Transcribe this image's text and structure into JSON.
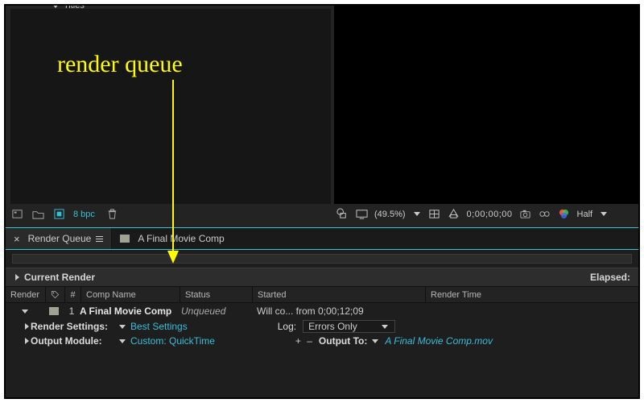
{
  "project": {
    "row_label": "Titles",
    "bpc_label": "8 bpc"
  },
  "viewer": {
    "zoom": "(49.5%)",
    "timecode": "0;00;00;00",
    "resolution": "Half"
  },
  "tabs": {
    "render_queue": "Render Queue",
    "comp_name": "A Final Movie Comp"
  },
  "current_render": {
    "title": "Current Render",
    "elapsed_label": "Elapsed:"
  },
  "columns": {
    "render": "Render",
    "tag": "",
    "num": "#",
    "comp": "Comp Name",
    "status": "Status",
    "started": "Started",
    "render_time": "Render Time"
  },
  "item": {
    "index": "1",
    "comp_name": "A Final Movie Comp",
    "status": "Unqueued",
    "started": "Will co... from 0;00;12;09",
    "render_settings_label": "Render Settings:",
    "render_settings_value": "Best Settings",
    "output_module_label": "Output Module:",
    "output_module_value": "Custom: QuickTime",
    "log_label": "Log:",
    "log_value": "Errors Only",
    "output_to_label": "Output To:",
    "output_to_value": "A Final Movie Comp.mov",
    "plus_minus": "+  –"
  },
  "annotation": {
    "label": "render queue"
  }
}
